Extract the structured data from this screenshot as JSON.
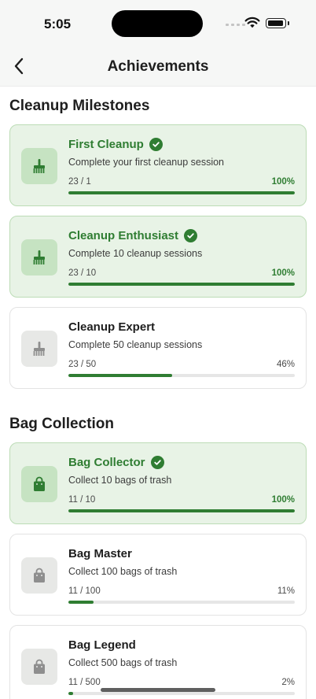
{
  "status_bar": {
    "time": "5:05"
  },
  "nav": {
    "title": "Achievements"
  },
  "colors": {
    "accent": "#2f7d32",
    "completed_bg": "#e8f3e6",
    "completed_border": "#bcdcb6",
    "track": "#e6e6e6"
  },
  "sections": [
    {
      "title": "Cleanup Milestones",
      "items": [
        {
          "title": "First Cleanup",
          "description": "Complete your first cleanup session",
          "progress_text": "23 / 1",
          "percent_text": "100%",
          "progress": 1.0,
          "completed": true,
          "icon": "broom-icon"
        },
        {
          "title": "Cleanup Enthusiast",
          "description": "Complete 10 cleanup sessions",
          "progress_text": "23 / 10",
          "percent_text": "100%",
          "progress": 1.0,
          "completed": true,
          "icon": "broom-icon"
        },
        {
          "title": "Cleanup Expert",
          "description": "Complete 50 cleanup sessions",
          "progress_text": "23 / 50",
          "percent_text": "46%",
          "progress": 0.46,
          "completed": false,
          "icon": "broom-icon"
        }
      ]
    },
    {
      "title": "Bag Collection",
      "items": [
        {
          "title": "Bag Collector",
          "description": "Collect 10 bags of trash",
          "progress_text": "11 / 10",
          "percent_text": "100%",
          "progress": 1.0,
          "completed": true,
          "icon": "shopping-bag-icon"
        },
        {
          "title": "Bag Master",
          "description": "Collect 100 bags of trash",
          "progress_text": "11 / 100",
          "percent_text": "11%",
          "progress": 0.11,
          "completed": false,
          "icon": "shopping-bag-icon"
        },
        {
          "title": "Bag Legend",
          "description": "Collect 500 bags of trash",
          "progress_text": "11 / 500",
          "percent_text": "2%",
          "progress": 0.02,
          "completed": false,
          "icon": "shopping-bag-icon"
        }
      ]
    }
  ]
}
